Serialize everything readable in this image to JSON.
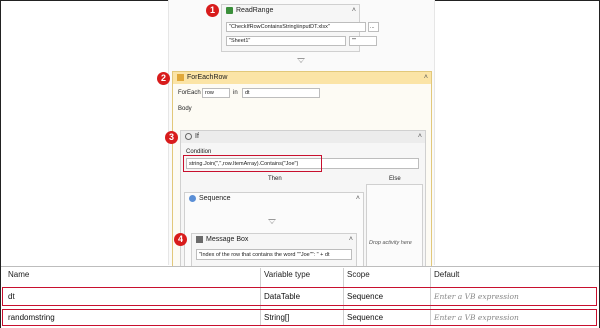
{
  "markers": [
    "1",
    "2",
    "3",
    "4"
  ],
  "read_range": {
    "title": "ReadRange",
    "workbook_path": "\"CheckIfRowContainsString\\inputDT.xlsx\"",
    "browse_label": "...",
    "sheet_name": "\"Sheet1\"",
    "range": "\"\""
  },
  "for_each_row": {
    "title": "ForEachRow",
    "foreach_label": "ForEach",
    "item": "row",
    "in_label": "in",
    "collection": "dt",
    "body_label": "Body"
  },
  "if_activity": {
    "title": "If",
    "condition_label": "Condition",
    "condition": "string.Join(\",\",row.ItemArray).Contains(\"Joe\")",
    "then_label": "Then",
    "else_label": "Else",
    "else_drop_text": "Drop activity here"
  },
  "sequence": {
    "title": "Sequence"
  },
  "message_box": {
    "title": "Message Box",
    "text": "\"Index of the row that contains the word \"\"Joe\"\": \" + dt"
  },
  "variables_panel": {
    "headers": [
      "Name",
      "Variable type",
      "Scope",
      "Default"
    ],
    "rows": [
      {
        "name": "dt",
        "type": "DataTable",
        "scope": "Sequence",
        "default_placeholder": "Enter a VB expression"
      },
      {
        "name": "randomstring",
        "type": "String[]",
        "scope": "Sequence",
        "default_placeholder": "Enter a VB expression"
      }
    ]
  },
  "colors": {
    "marker": "#d81c1c",
    "highlight_box": "#c8102e",
    "container_header": "#fbe4a6"
  },
  "icons": [
    "excel-read-icon",
    "foreach-icon",
    "if-icon",
    "sequence-icon",
    "message-box-icon",
    "collapse-chevron-icon",
    "drop-arrow-icon"
  ]
}
